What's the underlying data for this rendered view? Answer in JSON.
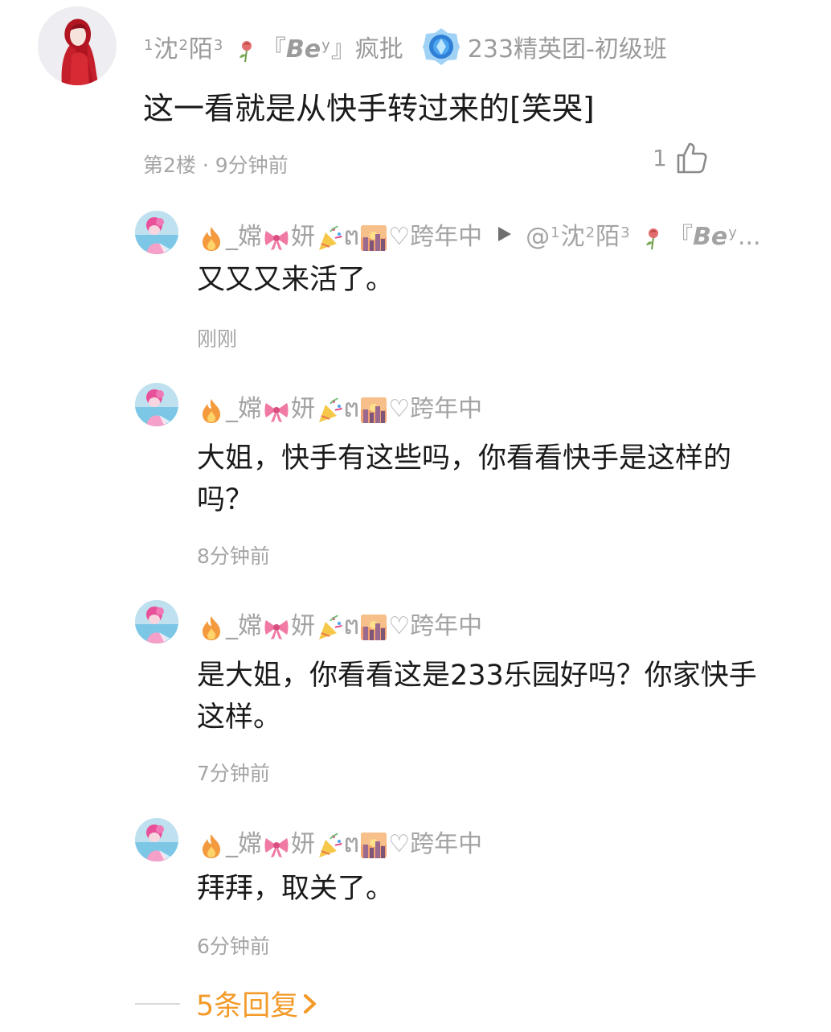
{
  "main_comment": {
    "username_prefix_1": "1",
    "username_char_1": "沈",
    "username_sup_2": "2",
    "username_char_2": "陌",
    "username_sup_3": "3",
    "username_bracket_open": "『",
    "username_bey": "Be",
    "username_bey_sup": "y",
    "username_bracket_close": "』",
    "username_suffix": "疯批",
    "rose_icon": "wilted-rose-emoji",
    "badge_icon": "blue-crystal-badge-icon",
    "group_name": "233精英团-初级班",
    "text": "这一看就是从快手转过来的[笑哭]",
    "floor": "第2楼",
    "dot": "·",
    "time": "9分钟前",
    "like_count": "1",
    "like_icon": "thumbs-up-icon"
  },
  "reply_user": {
    "name_part_1": "_嫦",
    "name_part_2": "妍",
    "name_part_3": "ຕ",
    "name_part_4": "♡跨年中",
    "fire_icon": "fire-emoji",
    "bow_icon": "pink-bow-emoji",
    "party_icon": "party-popper-emoji",
    "city_icon": "city-sunset-emoji"
  },
  "replies": [
    {
      "reply_to_prefix": "@",
      "reply_to_name": "沈",
      "reply_to_name_2": "陌",
      "reply_to_bey": "Be",
      "reply_to_ellipsis": "...",
      "text": "又又又来活了。",
      "time": "刚刚"
    },
    {
      "text": "大姐，快手有这些吗，你看看快手是这样的吗？",
      "time": "8分钟前"
    },
    {
      "text": "是大姐，你看看这是233乐园好吗？你家快手这样。",
      "time": "7分钟前"
    },
    {
      "text": "拜拜，取关了。",
      "time": "6分钟前"
    }
  ],
  "more_replies": {
    "label": "5条回复",
    "chevron_icon": "chevron-right-icon"
  },
  "colors": {
    "accent_orange": "#f39a29",
    "meta_gray": "#a5a5a5",
    "text_dark": "#1a1a1a"
  }
}
